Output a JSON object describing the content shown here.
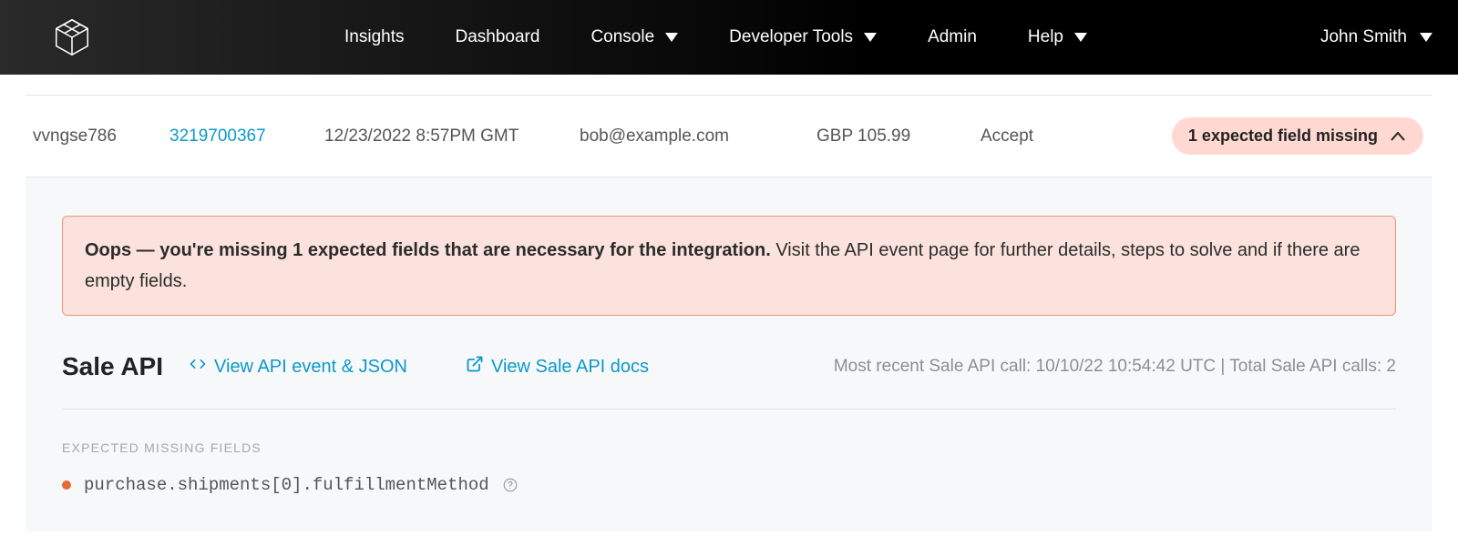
{
  "nav": {
    "items": [
      {
        "label": "Insights",
        "hasCaret": false
      },
      {
        "label": "Dashboard",
        "hasCaret": false
      },
      {
        "label": "Console",
        "hasCaret": true
      },
      {
        "label": "Developer Tools",
        "hasCaret": true
      },
      {
        "label": "Admin",
        "hasCaret": false
      },
      {
        "label": "Help",
        "hasCaret": true
      }
    ],
    "user": "John Smith"
  },
  "row": {
    "col0": "vvngse786",
    "col1": "3219700367",
    "col2": "12/23/2022 8:57PM GMT",
    "col3": "bob@example.com",
    "col4": "GBP 105.99",
    "col5": "Accept",
    "pill": "1 expected field missing"
  },
  "alert": {
    "bold": "Oops — you're missing 1 expected fields that are necessary for the integration.",
    "rest": " Visit the API event page for further details, steps to solve and if there are empty fields."
  },
  "api": {
    "title": "Sale API",
    "link1": "View API event & JSON",
    "link2": "View Sale API docs",
    "meta": "Most recent Sale API call: 10/10/22 10:54:42 UTC | Total Sale API calls: 2"
  },
  "missing": {
    "heading": "EXPECTED MISSING FIELDS",
    "field": "purchase.shipments[0].fulfillmentMethod"
  }
}
